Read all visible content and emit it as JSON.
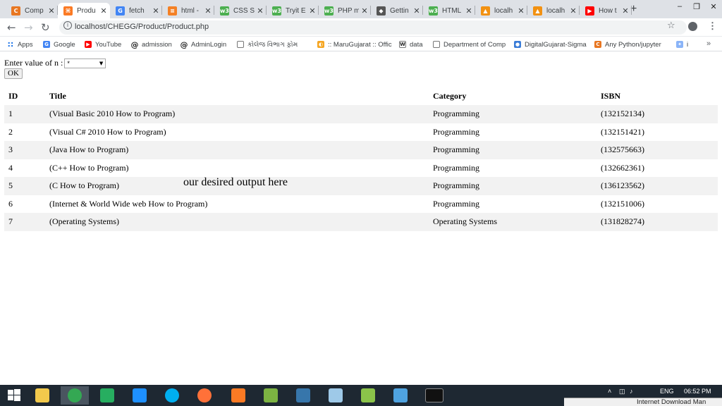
{
  "browser": {
    "tabs": [
      {
        "title": "Comp",
        "favicon": "chegg-icon",
        "color": "#e87722",
        "glyph": "C"
      },
      {
        "title": "Produ",
        "favicon": "xampp-icon",
        "color": "#fb7a24",
        "glyph": "⌘",
        "active": true
      },
      {
        "title": "fetch",
        "favicon": "google-icon",
        "color": "#4285f4",
        "glyph": "G"
      },
      {
        "title": "html -",
        "favicon": "stackoverflow-icon",
        "color": "#f48024",
        "glyph": "≡"
      },
      {
        "title": "CSS St",
        "favicon": "w3schools-icon",
        "color": "#4caf50",
        "glyph": "w3"
      },
      {
        "title": "Tryit E",
        "favicon": "w3schools-icon",
        "color": "#4caf50",
        "glyph": "w3"
      },
      {
        "title": "PHP m",
        "favicon": "w3schools-icon",
        "color": "#4caf50",
        "glyph": "w3"
      },
      {
        "title": "Gettin",
        "favicon": "diamond-icon",
        "color": "#555555",
        "glyph": "◆"
      },
      {
        "title": "HTML",
        "favicon": "w3schools-icon",
        "color": "#4caf50",
        "glyph": "w3"
      },
      {
        "title": "localh",
        "favicon": "phpmyadmin-icon",
        "color": "#f29111",
        "glyph": "▲"
      },
      {
        "title": "localh",
        "favicon": "phpmyadmin-icon",
        "color": "#f29111",
        "glyph": "▲"
      },
      {
        "title": "How t",
        "favicon": "youtube-icon",
        "color": "#ff0000",
        "glyph": "▶"
      }
    ],
    "url": "localhost/CHEGG/Product/Product.php",
    "bookmarks": [
      {
        "label": "Apps",
        "icon": "apps-grid-icon",
        "color": "#1a73e8",
        "glyph": "∷"
      },
      {
        "label": "Google",
        "icon": "google-icon",
        "color": "#4285f4",
        "glyph": "G"
      },
      {
        "label": "YouTube",
        "icon": "youtube-icon",
        "color": "#ff0000",
        "glyph": "▶"
      },
      {
        "label": "admission",
        "icon": "at-sign-icon",
        "color": "#222222",
        "glyph": "@"
      },
      {
        "label": "AdminLogin",
        "icon": "at-sign-icon",
        "color": "#222222",
        "glyph": "@"
      },
      {
        "label": "કોલેજ વિભાગ ફ઼ોમ",
        "icon": "page-icon",
        "color": "#ffffff",
        "glyph": ""
      },
      {
        "label": ":: MaruGujarat :: Offic",
        "icon": "marugujarat-icon",
        "color": "#f5a623",
        "glyph": "◐"
      },
      {
        "label": "data",
        "icon": "wikipedia-icon",
        "color": "#ffffff",
        "glyph": "W"
      },
      {
        "label": "Department of Comp",
        "icon": "page-icon",
        "color": "#ffffff",
        "glyph": ""
      },
      {
        "label": "DigitalGujarat-Sigma",
        "icon": "digitalgujarat-icon",
        "color": "#3b7dd8",
        "glyph": "●"
      },
      {
        "label": "Any Python/jupyter",
        "icon": "chegg-icon",
        "color": "#e87722",
        "glyph": "C"
      },
      {
        "label": "i",
        "icon": "extension-icon",
        "color": "#8ab4f8",
        "glyph": "✦"
      }
    ]
  },
  "form": {
    "label": "Enter value of n :",
    "select_value": "*",
    "submit_label": "OK"
  },
  "table": {
    "headers": [
      "ID",
      "Title",
      "Category",
      "ISBN"
    ],
    "rows": [
      [
        "1",
        "(Visual Basic 2010 How to Program)",
        "Programming",
        "(132152134)"
      ],
      [
        "2",
        "(Visual C# 2010 How to Program)",
        "Programming",
        "(132151421)"
      ],
      [
        "3",
        "(Java How to Program)",
        "Programming",
        "(132575663)"
      ],
      [
        "4",
        "(C++ How to Program)",
        "Programming",
        "(132662361)"
      ],
      [
        "5",
        "(C How to Program)",
        "Programming",
        "(136123562)"
      ],
      [
        "6",
        "(Internet & World Wide web How to Program)",
        "Programming",
        "(132151006)"
      ],
      [
        "7",
        "(Operating Systems)",
        "Operating Systems",
        "(131828274)"
      ]
    ]
  },
  "annotation": "our desired output here",
  "taskbar": {
    "apps": [
      {
        "name": "start-icon",
        "color": "#ffffff"
      },
      {
        "name": "file-explorer-icon",
        "color": "#f2c94c"
      },
      {
        "name": "chrome-icon",
        "color": "#34a853",
        "active": true
      },
      {
        "name": "store-icon",
        "color": "#27ae60"
      },
      {
        "name": "internet-explorer-icon",
        "color": "#1e90ff"
      },
      {
        "name": "skype-icon",
        "color": "#00aff0"
      },
      {
        "name": "firefox-icon",
        "color": "#ff7139"
      },
      {
        "name": "xampp-icon",
        "color": "#fb7a24"
      },
      {
        "name": "network-tool-icon",
        "color": "#7cb342"
      },
      {
        "name": "python-icon",
        "color": "#3776ab"
      },
      {
        "name": "notepad-icon",
        "color": "#9ec9e8"
      },
      {
        "name": "chart-app-icon",
        "color": "#8bc34a"
      },
      {
        "name": "remote-desktop-icon",
        "color": "#4fa3e0"
      },
      {
        "name": "command-prompt-icon",
        "color": "#111111"
      }
    ],
    "language": "ENG",
    "time": "06:52 PM",
    "notification": "Internet Download Man"
  }
}
